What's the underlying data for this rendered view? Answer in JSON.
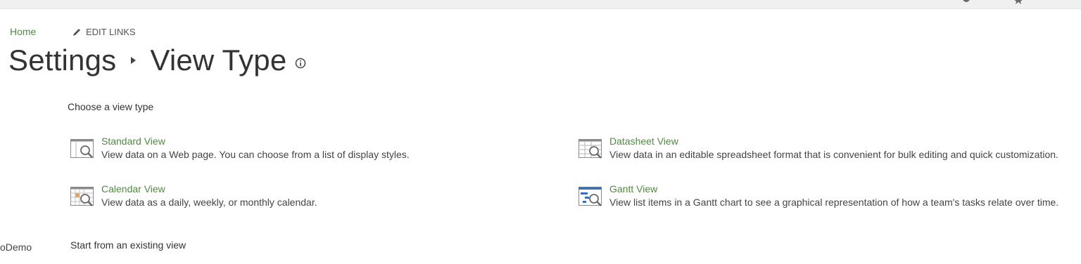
{
  "breadcrumb": {
    "home_label": "Home",
    "edit_links_label": "EDIT LINKS"
  },
  "page": {
    "title_part1": "Settings",
    "title_part2": "View Type"
  },
  "choose": {
    "heading": "Choose a view type",
    "view_types": [
      {
        "name": "Standard View",
        "description": "View data on a Web page. You can choose from a list of display styles.",
        "icon": "standard-view-icon"
      },
      {
        "name": "Datasheet View",
        "description": "View data in an editable spreadsheet format that is convenient for bulk editing and quick customization.",
        "icon": "datasheet-view-icon"
      },
      {
        "name": "Calendar View",
        "description": "View data as a daily, weekly, or monthly calendar.",
        "icon": "calendar-view-icon"
      },
      {
        "name": "Gantt View",
        "description": "View list items in a Gantt chart to see a graphical representation of how a team's tasks relate over time.",
        "icon": "gantt-view-icon"
      }
    ]
  },
  "existing": {
    "heading": "Start from an existing view"
  },
  "sidebar": {
    "partial_label": "oDemo"
  },
  "colors": {
    "link_green": "#4f8a3f",
    "text": "#333333",
    "gantt_blue": "#3a6fb6"
  }
}
